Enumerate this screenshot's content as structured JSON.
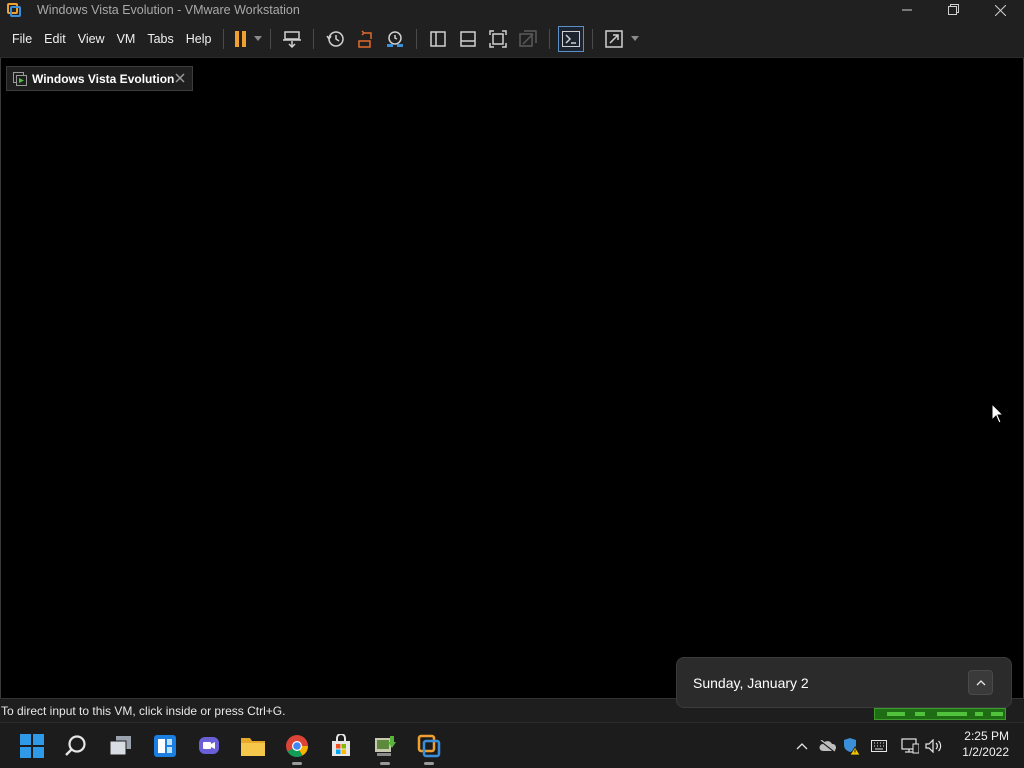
{
  "window": {
    "title": "Windows Vista Evolution - VMware Workstation",
    "app_icon": "vmware-icon",
    "controls": [
      "minimize-icon",
      "restore-icon",
      "close-icon"
    ]
  },
  "menubar": {
    "items": [
      {
        "label": "File"
      },
      {
        "label": "Edit"
      },
      {
        "label": "View"
      },
      {
        "label": "VM"
      },
      {
        "label": "Tabs"
      },
      {
        "label": "Help"
      }
    ],
    "toolbar_icons": [
      "pause-icon",
      "send-ctrl-alt-del-icon",
      "snapshot-icon",
      "revert-snapshot-icon",
      "snapshot-manager-icon",
      "show-library-icon",
      "show-thumbnail-bar-icon",
      "full-screen-icon",
      "unity-icon",
      "console-view-icon",
      "stretch-guest-icon"
    ],
    "accent_color": "#f0a030"
  },
  "tab": {
    "label": "Windows Vista Evolution"
  },
  "status": {
    "text": "To direct input to this VM, click inside or press Ctrl+G."
  },
  "flyout": {
    "date": "Sunday, January 2"
  },
  "taskbar": {
    "apps": [
      "windows-start-icon",
      "search-icon",
      "task-view-icon",
      "widgets-icon",
      "teams-chat-icon",
      "file-explorer-icon",
      "chrome-icon",
      "microsoft-store-icon",
      "installer-app-icon",
      "vmware-icon"
    ],
    "tray_icons": [
      "chevron-up-icon",
      "onedrive-icon",
      "defender-icon",
      "keyboard-icon",
      "network-icon",
      "volume-icon"
    ],
    "clock": {
      "time": "2:25 PM",
      "date": "1/2/2022"
    }
  }
}
